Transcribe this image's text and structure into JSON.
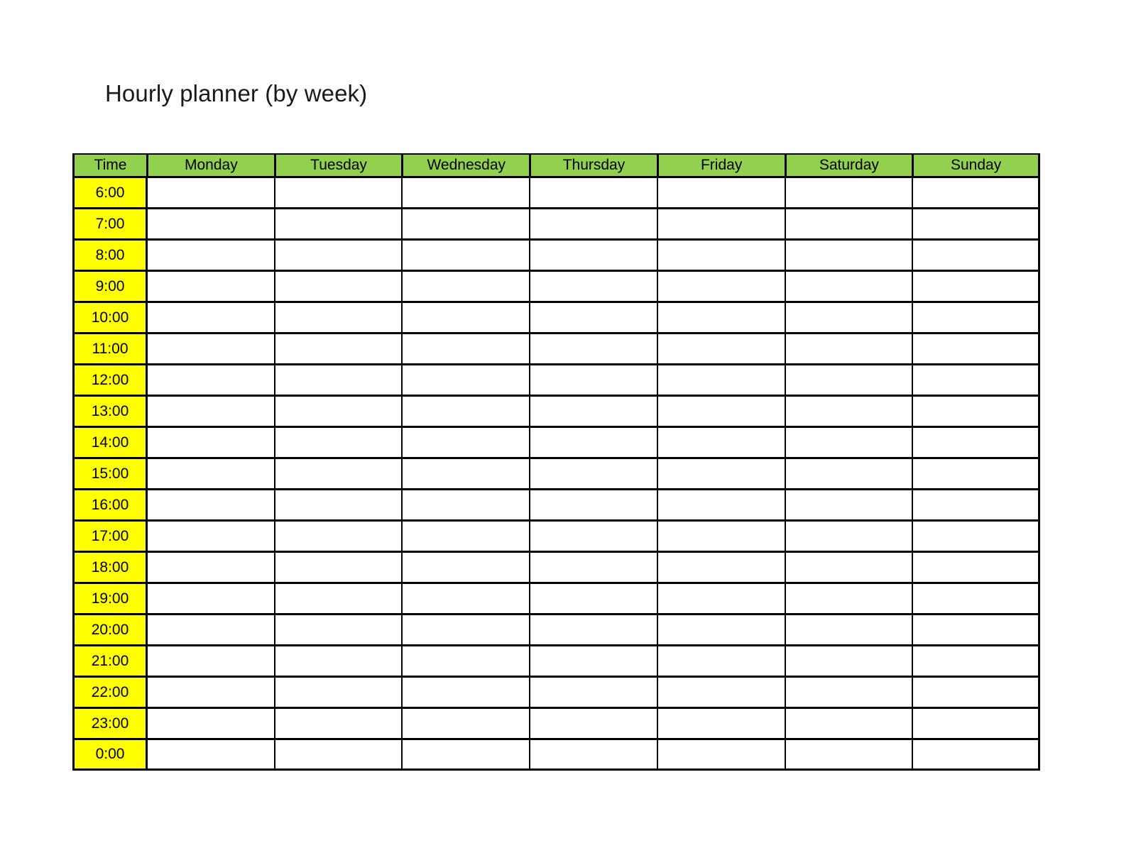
{
  "document": {
    "title": "Hourly planner (by week)"
  },
  "colors": {
    "header_background": "#92D050",
    "time_background": "#FFFF00",
    "cell_background": "#FFFFFF",
    "grid_line": "#000000",
    "text": "#000000"
  },
  "table": {
    "columns": [
      {
        "key": "time",
        "label": "Time",
        "type": "time"
      },
      {
        "key": "monday",
        "label": "Monday",
        "type": "day"
      },
      {
        "key": "tuesday",
        "label": "Tuesday",
        "type": "day"
      },
      {
        "key": "wednesday",
        "label": "Wednesday",
        "type": "day"
      },
      {
        "key": "thursday",
        "label": "Thursday",
        "type": "day"
      },
      {
        "key": "friday",
        "label": "Friday",
        "type": "day"
      },
      {
        "key": "saturday",
        "label": "Saturday",
        "type": "day"
      },
      {
        "key": "sunday",
        "label": "Sunday",
        "type": "day"
      }
    ],
    "rows": [
      {
        "time": "6:00",
        "entries": [
          "",
          "",
          "",
          "",
          "",
          "",
          ""
        ]
      },
      {
        "time": "7:00",
        "entries": [
          "",
          "",
          "",
          "",
          "",
          "",
          ""
        ]
      },
      {
        "time": "8:00",
        "entries": [
          "",
          "",
          "",
          "",
          "",
          "",
          ""
        ]
      },
      {
        "time": "9:00",
        "entries": [
          "",
          "",
          "",
          "",
          "",
          "",
          ""
        ]
      },
      {
        "time": "10:00",
        "entries": [
          "",
          "",
          "",
          "",
          "",
          "",
          ""
        ]
      },
      {
        "time": "11:00",
        "entries": [
          "",
          "",
          "",
          "",
          "",
          "",
          ""
        ]
      },
      {
        "time": "12:00",
        "entries": [
          "",
          "",
          "",
          "",
          "",
          "",
          ""
        ]
      },
      {
        "time": "13:00",
        "entries": [
          "",
          "",
          "",
          "",
          "",
          "",
          ""
        ]
      },
      {
        "time": "14:00",
        "entries": [
          "",
          "",
          "",
          "",
          "",
          "",
          ""
        ]
      },
      {
        "time": "15:00",
        "entries": [
          "",
          "",
          "",
          "",
          "",
          "",
          ""
        ]
      },
      {
        "time": "16:00",
        "entries": [
          "",
          "",
          "",
          "",
          "",
          "",
          ""
        ]
      },
      {
        "time": "17:00",
        "entries": [
          "",
          "",
          "",
          "",
          "",
          "",
          ""
        ]
      },
      {
        "time": "18:00",
        "entries": [
          "",
          "",
          "",
          "",
          "",
          "",
          ""
        ]
      },
      {
        "time": "19:00",
        "entries": [
          "",
          "",
          "",
          "",
          "",
          "",
          ""
        ]
      },
      {
        "time": "20:00",
        "entries": [
          "",
          "",
          "",
          "",
          "",
          "",
          ""
        ]
      },
      {
        "time": "21:00",
        "entries": [
          "",
          "",
          "",
          "",
          "",
          "",
          ""
        ]
      },
      {
        "time": "22:00",
        "entries": [
          "",
          "",
          "",
          "",
          "",
          "",
          ""
        ]
      },
      {
        "time": "23:00",
        "entries": [
          "",
          "",
          "",
          "",
          "",
          "",
          ""
        ]
      },
      {
        "time": "0:00",
        "entries": [
          "",
          "",
          "",
          "",
          "",
          "",
          ""
        ]
      }
    ]
  }
}
